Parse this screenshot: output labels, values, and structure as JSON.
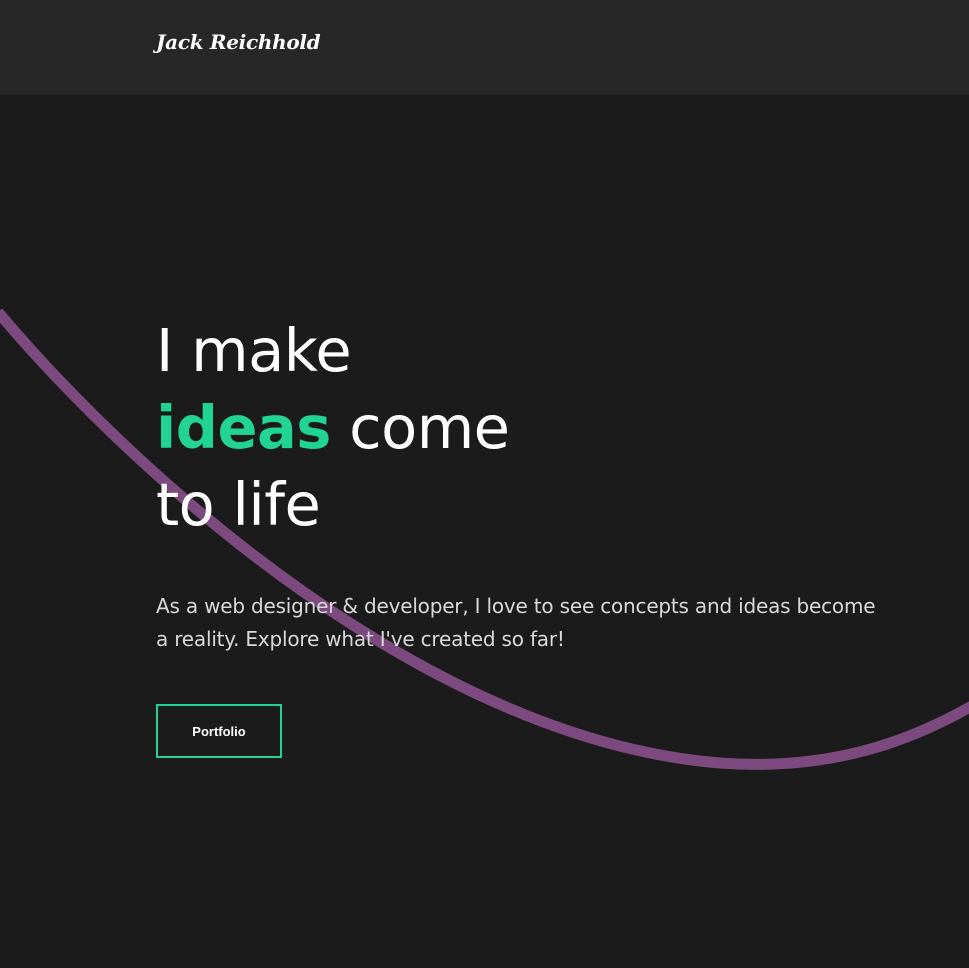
{
  "header": {
    "logo_text": "Jack Reichhold"
  },
  "hero": {
    "headline_line1": "I make",
    "headline_accent": "ideas",
    "headline_line2_rest": " come",
    "headline_line3": "to life",
    "intro": "As a web designer & developer, I love to see concepts and ideas become a reality. Explore what I've created so far!",
    "cta_label": "Portfolio"
  },
  "colors": {
    "background": "#1b1b1b",
    "header_background": "#272727",
    "accent": "#22d493",
    "curve": "#7c4a7e",
    "text": "#ffffff",
    "muted_text": "#d9d9d9"
  }
}
